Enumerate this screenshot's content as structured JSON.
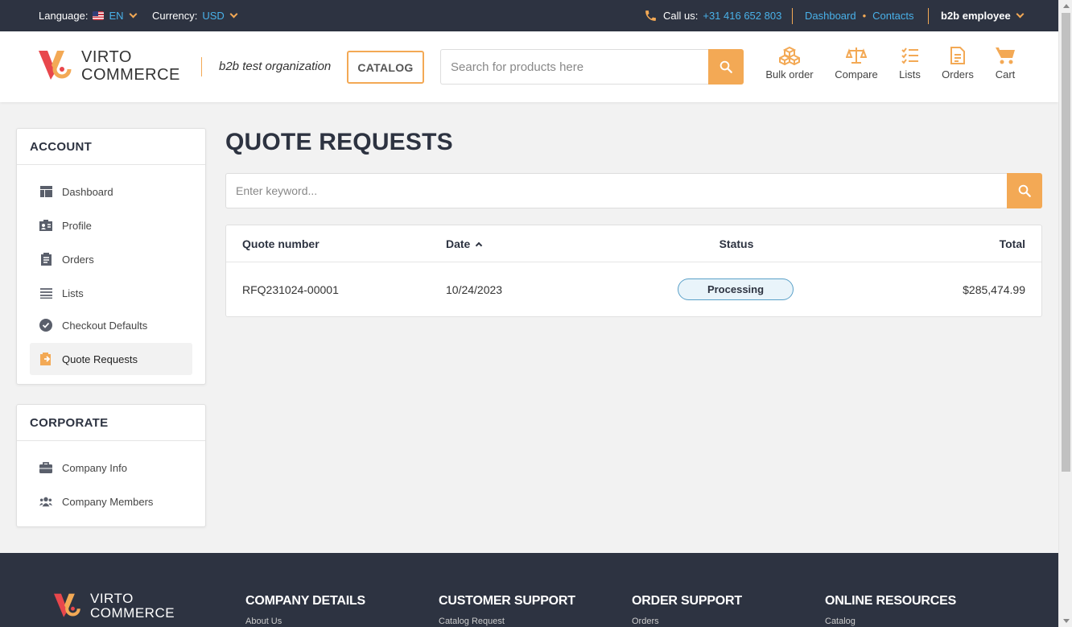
{
  "topbar": {
    "language_label": "Language:",
    "language_value": "EN",
    "currency_label": "Currency:",
    "currency_value": "USD",
    "call_label": "Call us:",
    "phone": "+31 416 652 803",
    "dashboard_link": "Dashboard",
    "contacts_link": "Contacts",
    "user_menu": "b2b employee"
  },
  "header": {
    "logo_line1": "VIRTO",
    "logo_line2": "COMMERCE",
    "organization": "b2b test organization",
    "catalog_button": "CATALOG",
    "search_placeholder": "Search for products here",
    "icons": [
      {
        "label": "Bulk order",
        "icon": "boxes-icon"
      },
      {
        "label": "Compare",
        "icon": "scales-icon"
      },
      {
        "label": "Lists",
        "icon": "checklist-icon"
      },
      {
        "label": "Orders",
        "icon": "document-icon"
      },
      {
        "label": "Cart",
        "icon": "cart-icon"
      }
    ]
  },
  "sidebar": {
    "account_title": "ACCOUNT",
    "account_items": [
      {
        "label": "Dashboard",
        "icon": "dashboard-icon"
      },
      {
        "label": "Profile",
        "icon": "profile-card-icon"
      },
      {
        "label": "Orders",
        "icon": "clipboard-icon"
      },
      {
        "label": "Lists",
        "icon": "list-icon"
      },
      {
        "label": "Checkout Defaults",
        "icon": "check-circle-icon"
      },
      {
        "label": "Quote Requests",
        "icon": "quote-request-icon",
        "active": true
      }
    ],
    "corporate_title": "CORPORATE",
    "corporate_items": [
      {
        "label": "Company Info",
        "icon": "briefcase-icon"
      },
      {
        "label": "Company Members",
        "icon": "members-icon"
      }
    ]
  },
  "main": {
    "title": "QUOTE REQUESTS",
    "keyword_placeholder": "Enter keyword...",
    "table": {
      "headers": {
        "quote_number": "Quote number",
        "date": "Date",
        "status": "Status",
        "total": "Total"
      },
      "rows": [
        {
          "quote_number": "RFQ231024-00001",
          "date": "10/24/2023",
          "status": "Processing",
          "total": "$285,474.99"
        }
      ]
    }
  },
  "footer": {
    "logo_line1": "VIRTO",
    "logo_line2": "COMMERCE",
    "columns": [
      {
        "heading": "COMPANY DETAILS",
        "first_link": "About Us"
      },
      {
        "heading": "CUSTOMER SUPPORT",
        "first_link": "Catalog Request"
      },
      {
        "heading": "ORDER SUPPORT",
        "first_link": "Orders"
      },
      {
        "heading": "ONLINE RESOURCES",
        "first_link": "Catalog"
      }
    ]
  },
  "colors": {
    "accent": "#f3a955",
    "dark": "#2d3341",
    "link": "#49b1e9"
  }
}
